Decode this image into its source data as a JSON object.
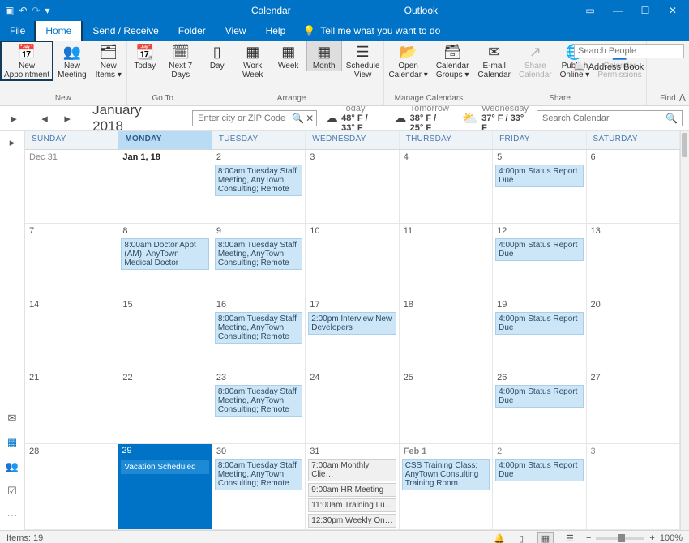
{
  "title": {
    "left": "Calendar",
    "right": "Outlook"
  },
  "tabs": [
    "File",
    "Home",
    "Send / Receive",
    "Folder",
    "View",
    "Help"
  ],
  "tell_me": "Tell me what you want to do",
  "ribbon": {
    "groups": {
      "new": {
        "label": "New",
        "appointment": "New\nAppointment",
        "meeting": "New\nMeeting",
        "items": "New\nItems ▾"
      },
      "goto": {
        "label": "Go To",
        "today": "Today",
        "next7": "Next 7\nDays"
      },
      "arrange": {
        "label": "Arrange",
        "day": "Day",
        "workweek": "Work\nWeek",
        "week": "Week",
        "month": "Month",
        "schedule": "Schedule\nView"
      },
      "manage": {
        "label": "Manage Calendars",
        "open": "Open\nCalendar ▾",
        "groups": "Calendar\nGroups ▾"
      },
      "share": {
        "label": "Share",
        "email": "E-mail\nCalendar",
        "share": "Share\nCalendar",
        "publish": "Publish\nOnline ▾",
        "perm": "Calendar\nPermissions"
      },
      "find": {
        "label": "Find",
        "searchppl": "Search People",
        "address": "Address Book"
      }
    }
  },
  "subbar": {
    "month_label": "January 2018",
    "zip_placeholder": "Enter city or ZIP Code",
    "search_placeholder": "Search Calendar",
    "weather": [
      {
        "icon": "☁",
        "label": "Today",
        "temp": "48° F / 33° F"
      },
      {
        "icon": "☁",
        "label": "Tomorrow",
        "temp": "38° F / 25° F"
      },
      {
        "icon": "⛅",
        "label": "Wednesday",
        "temp": "37° F / 33° F"
      }
    ]
  },
  "dayheaders": [
    "SUNDAY",
    "MONDAY",
    "TUESDAY",
    "WEDNESDAY",
    "THURSDAY",
    "FRIDAY",
    "SATURDAY"
  ],
  "weeks": [
    [
      {
        "label": "Dec 31",
        "other": true
      },
      {
        "label": "Jan 1, 18",
        "bold": true
      },
      {
        "label": "2",
        "events": [
          {
            "t": "8:00am Tuesday Staff Meeting, AnyTown Consulting; Remote"
          }
        ]
      },
      {
        "label": "3"
      },
      {
        "label": "4"
      },
      {
        "label": "5",
        "events": [
          {
            "t": "4:00pm Status Report Due"
          }
        ]
      },
      {
        "label": "6"
      }
    ],
    [
      {
        "label": "7"
      },
      {
        "label": "8",
        "events": [
          {
            "t": "8:00am Doctor Appt (AM); AnyTown Medical Doctor"
          }
        ]
      },
      {
        "label": "9",
        "events": [
          {
            "t": "8:00am Tuesday Staff Meeting, AnyTown Consulting; Remote"
          }
        ]
      },
      {
        "label": "10"
      },
      {
        "label": "11"
      },
      {
        "label": "12",
        "events": [
          {
            "t": "4:00pm Status Report Due"
          }
        ]
      },
      {
        "label": "13"
      }
    ],
    [
      {
        "label": "14"
      },
      {
        "label": "15"
      },
      {
        "label": "16",
        "events": [
          {
            "t": "8:00am Tuesday Staff Meeting, AnyTown Consulting; Remote"
          }
        ]
      },
      {
        "label": "17",
        "events": [
          {
            "t": "2:00pm Interview New Developers"
          }
        ]
      },
      {
        "label": "18"
      },
      {
        "label": "19",
        "events": [
          {
            "t": "4:00pm Status Report Due"
          }
        ]
      },
      {
        "label": "20"
      }
    ],
    [
      {
        "label": "21"
      },
      {
        "label": "22"
      },
      {
        "label": "23",
        "events": [
          {
            "t": "8:00am Tuesday Staff Meeting, AnyTown Consulting; Remote"
          }
        ]
      },
      {
        "label": "24"
      },
      {
        "label": "25"
      },
      {
        "label": "26",
        "events": [
          {
            "t": "4:00pm Status Report Due"
          }
        ]
      },
      {
        "label": "27"
      }
    ],
    [
      {
        "label": "28"
      },
      {
        "label": "29",
        "selected": true,
        "events": [
          {
            "t": "Vacation Scheduled",
            "sel": true
          }
        ]
      },
      {
        "label": "30",
        "events": [
          {
            "t": "8:00am Tuesday Staff Meeting, AnyTown Consulting; Remote"
          }
        ]
      },
      {
        "label": "31",
        "events": [
          {
            "t": "7:00am Monthly Clie…",
            "plain": true
          },
          {
            "t": "9:00am HR Meeting",
            "plain": true
          },
          {
            "t": "11:00am Training Lu…",
            "plain": true
          },
          {
            "t": "12:30pm Weekly On…",
            "plain": true
          }
        ]
      },
      {
        "label": "Feb 1",
        "bold": true,
        "other": true,
        "events": [
          {
            "t": "CSS Training Class; AnyTown Consulting Training Room"
          }
        ]
      },
      {
        "label": "2",
        "other": true,
        "events": [
          {
            "t": "4:00pm Status Report Due"
          }
        ]
      },
      {
        "label": "3",
        "other": true
      }
    ]
  ],
  "status": {
    "items": "Items: 19",
    "zoom": "100%"
  }
}
